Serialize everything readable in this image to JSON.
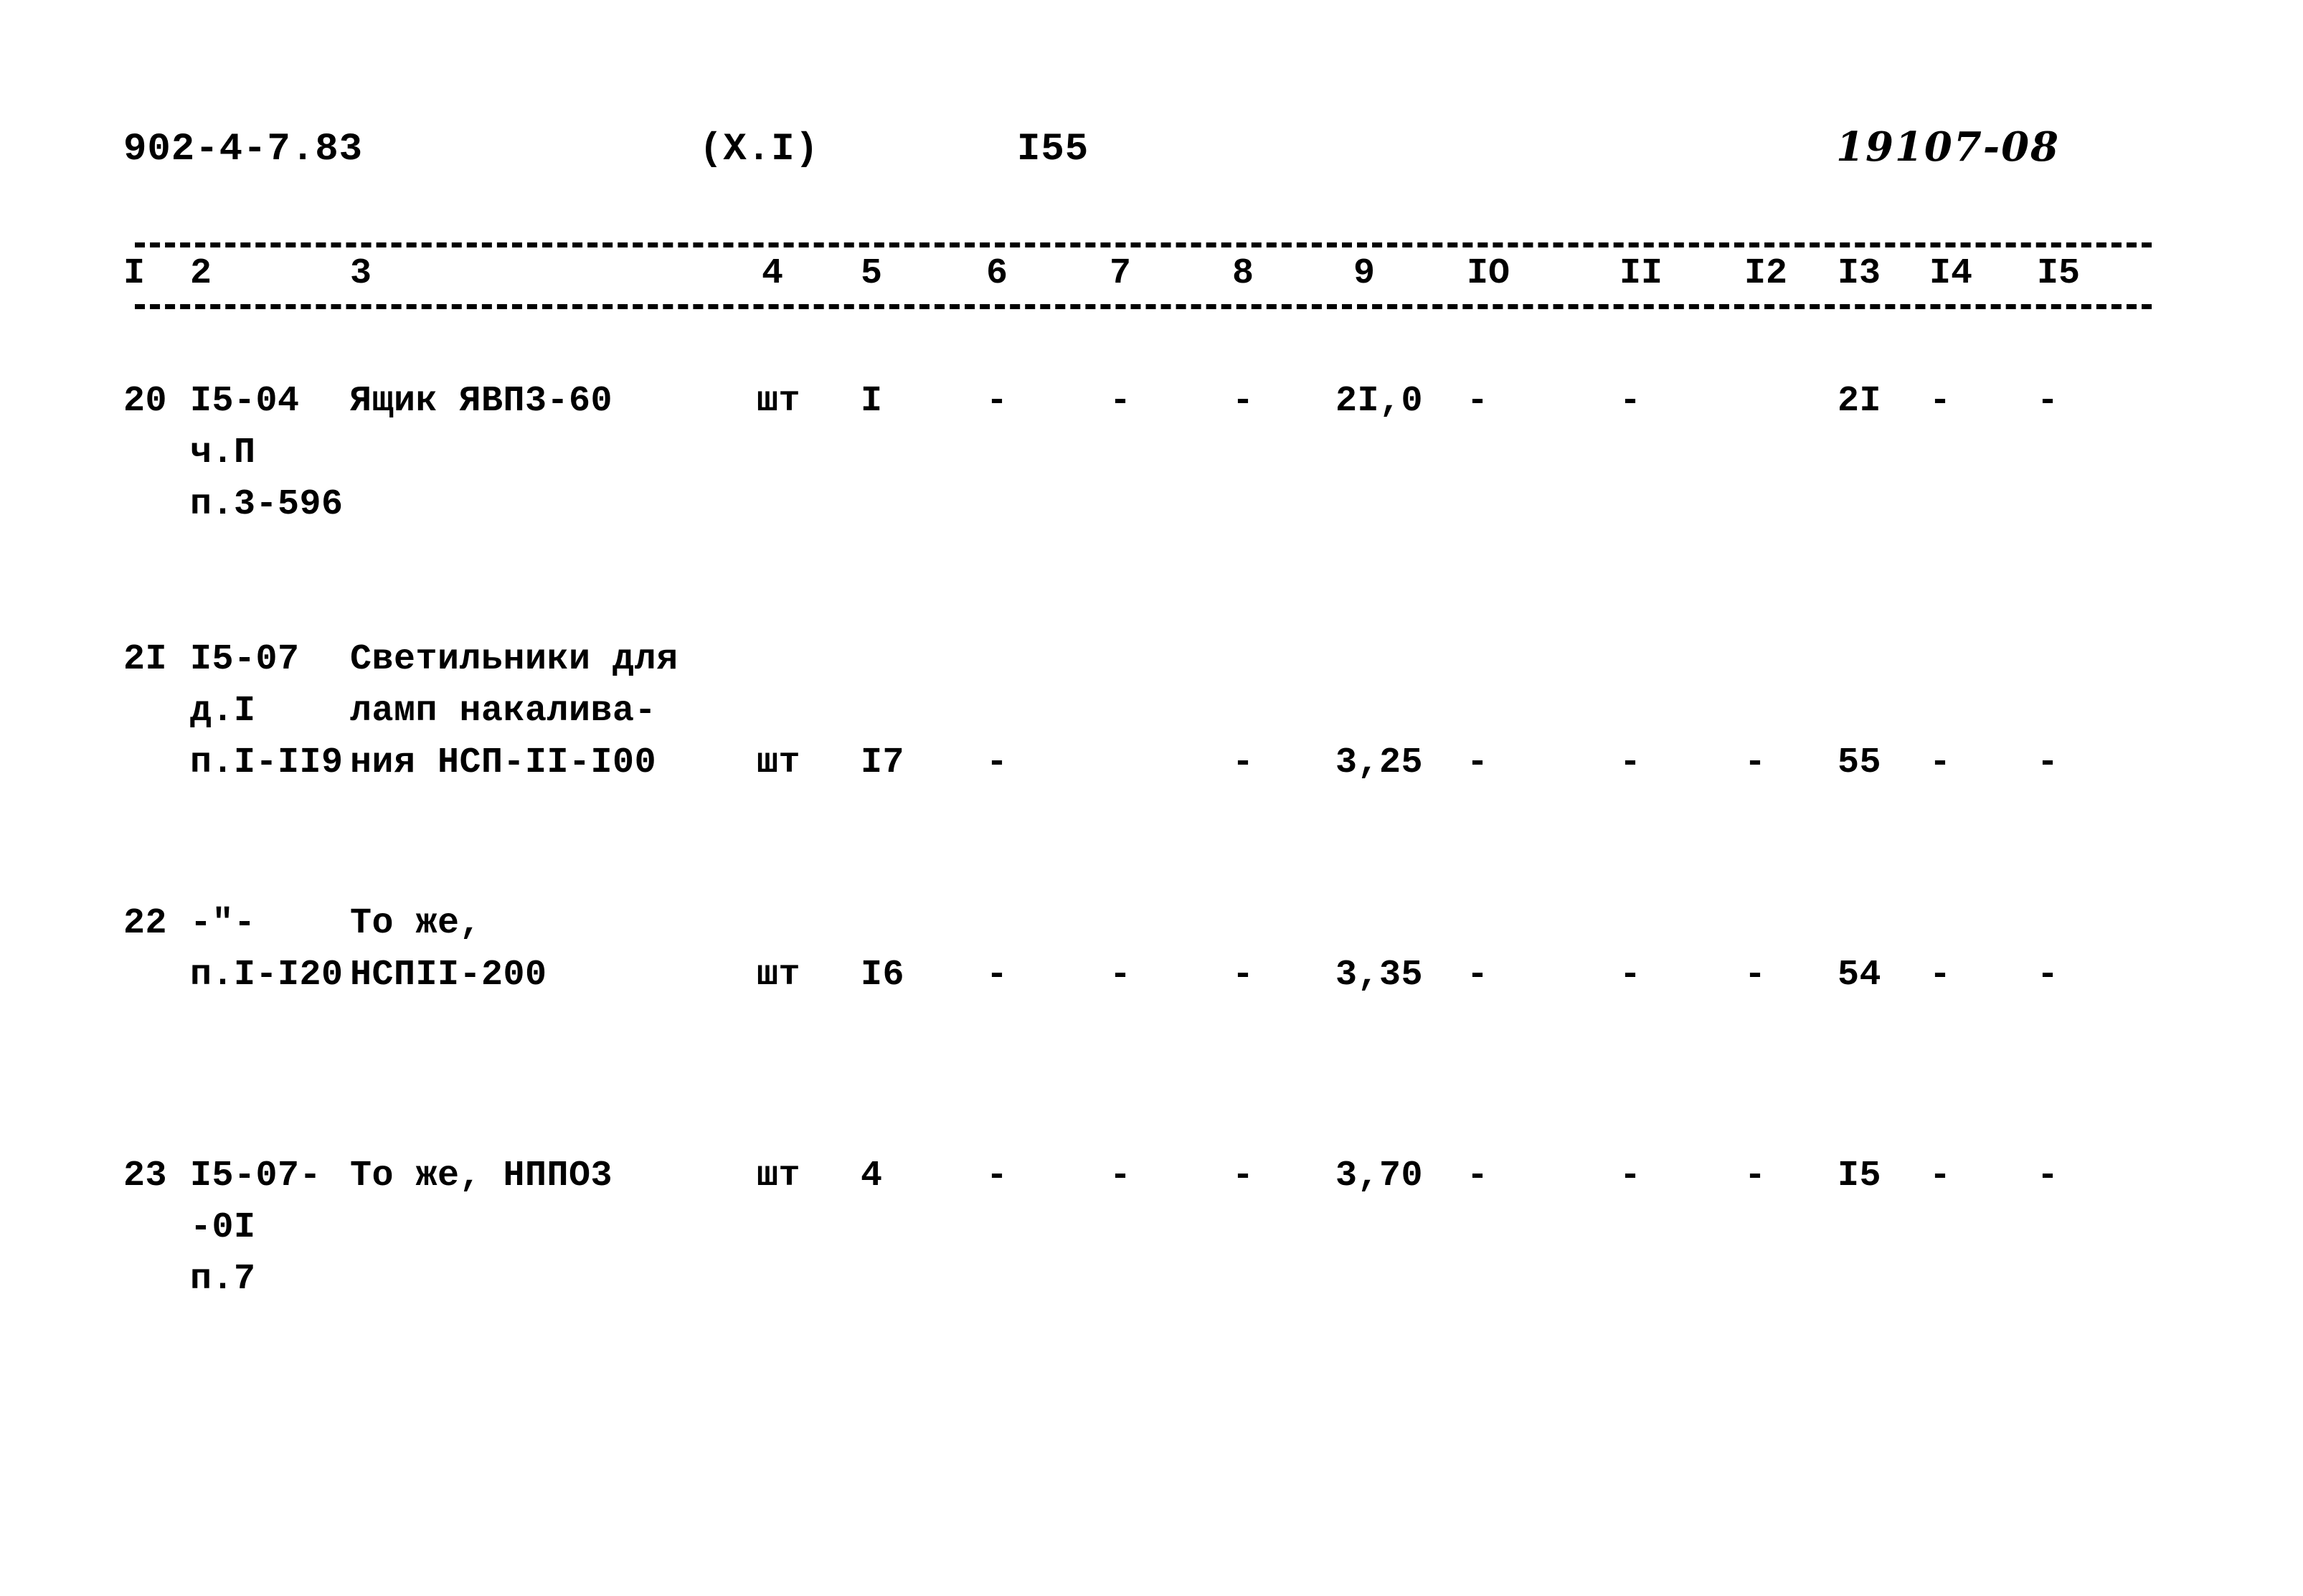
{
  "header": {
    "doc_code": "902-4-7.83",
    "section": "(X.I)",
    "page_number": "I55",
    "stamp_code": "19107-08"
  },
  "table": {
    "column_numbers": [
      "I",
      "2",
      "3",
      "4",
      "5",
      "6",
      "7",
      "8",
      "9",
      "IO",
      "II",
      "I2",
      "I3",
      "I4",
      "I5"
    ],
    "rows": [
      {
        "c1": "20",
        "c2": "I5-04\nч.П\nп.3-596",
        "c3": "Ящик ЯВП3-60",
        "c4": "шт",
        "c5": "I",
        "c6": "-",
        "c7": "-",
        "c8": "-",
        "c9": "2I,0",
        "c10": "-",
        "c11": "-",
        "c12": "",
        "c13": "2I",
        "c14": "-",
        "c15": "-"
      },
      {
        "c1": "2I",
        "c2": "I5-07\nд.I\nп.I-II9",
        "c3": "Светильники для\nламп накалива-\nния НСП-II-I00",
        "c4": "шт",
        "c5": "I7",
        "c6": "-",
        "c7": "",
        "c8": "-",
        "c9": "3,25",
        "c10": "-",
        "c11": "-",
        "c12": "-",
        "c13": "55",
        "c14": "-",
        "c15": "-"
      },
      {
        "c1": "22",
        "c2": "-\"-\nп.I-I20",
        "c3": "То же,\nНСПII-200",
        "c4": "шт",
        "c5": "I6",
        "c6": "-",
        "c7": "-",
        "c8": "-",
        "c9": "3,35",
        "c10": "-",
        "c11": "-",
        "c12": "-",
        "c13": "54",
        "c14": "-",
        "c15": "-"
      },
      {
        "c1": "23",
        "c2": "I5-07-\n  -0I\nп.7",
        "c3": "То же, НППО3",
        "c4": "шт",
        "c5": "4",
        "c6": "-",
        "c7": "-",
        "c8": "-",
        "c9": "3,70",
        "c10": "-",
        "c11": "-",
        "c12": "-",
        "c13": "I5",
        "c14": "-",
        "c15": "-"
      }
    ]
  }
}
